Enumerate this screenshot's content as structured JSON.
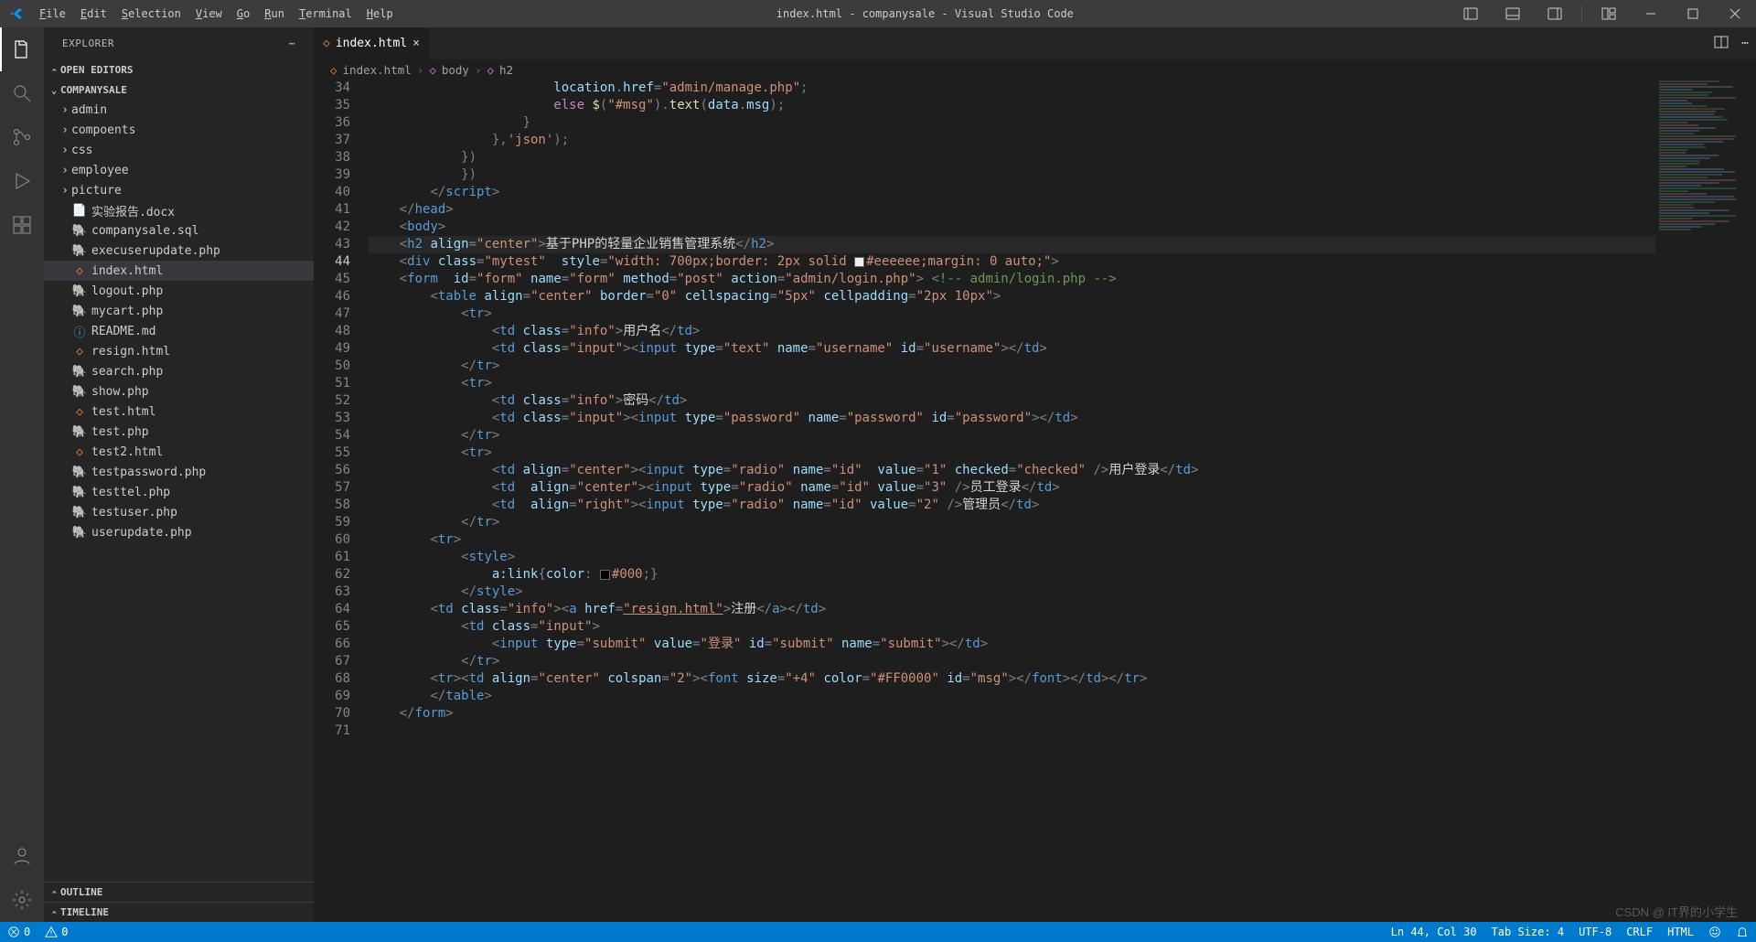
{
  "window": {
    "title": "index.html - companysale - Visual Studio Code"
  },
  "menu": [
    "File",
    "Edit",
    "Selection",
    "View",
    "Go",
    "Run",
    "Terminal",
    "Help"
  ],
  "activity": {
    "items": [
      "explorer",
      "search",
      "source-control",
      "run-debug",
      "extensions"
    ],
    "bottom": [
      "accounts",
      "manage"
    ]
  },
  "explorer": {
    "title": "EXPLORER",
    "openEditors": "OPEN EDITORS",
    "project": "COMPANYSALE",
    "folders": [
      "admin",
      "compoents",
      "css",
      "employee",
      "picture"
    ],
    "files": [
      {
        "name": "实验报告.docx",
        "icon": "doc"
      },
      {
        "name": "companysale.sql",
        "icon": "sql"
      },
      {
        "name": "execuserupdate.php",
        "icon": "php"
      },
      {
        "name": "index.html",
        "icon": "html",
        "active": true
      },
      {
        "name": "logout.php",
        "icon": "php"
      },
      {
        "name": "mycart.php",
        "icon": "php"
      },
      {
        "name": "README.md",
        "icon": "md"
      },
      {
        "name": "resign.html",
        "icon": "html"
      },
      {
        "name": "search.php",
        "icon": "php"
      },
      {
        "name": "show.php",
        "icon": "php"
      },
      {
        "name": "test.html",
        "icon": "html"
      },
      {
        "name": "test.php",
        "icon": "php"
      },
      {
        "name": "test2.html",
        "icon": "html"
      },
      {
        "name": "testpassword.php",
        "icon": "php"
      },
      {
        "name": "testtel.php",
        "icon": "php"
      },
      {
        "name": "testuser.php",
        "icon": "php"
      },
      {
        "name": "userupdate.php",
        "icon": "php"
      }
    ],
    "outline": "OUTLINE",
    "timeline": "TIMELINE"
  },
  "tabs": {
    "open": [
      {
        "label": "index.html"
      }
    ]
  },
  "breadcrumb": [
    "index.html",
    "body",
    "h2"
  ],
  "editor": {
    "startLine": 34,
    "highlight": 44
  },
  "status": {
    "errors": "0",
    "warnings": "0",
    "ln": "Ln 44, Col 30",
    "tabsize": "Tab Size: 4",
    "encoding": "UTF-8",
    "eol": "CRLF",
    "lang": "HTML"
  },
  "watermark": "CSDN @ IT界的小学生"
}
